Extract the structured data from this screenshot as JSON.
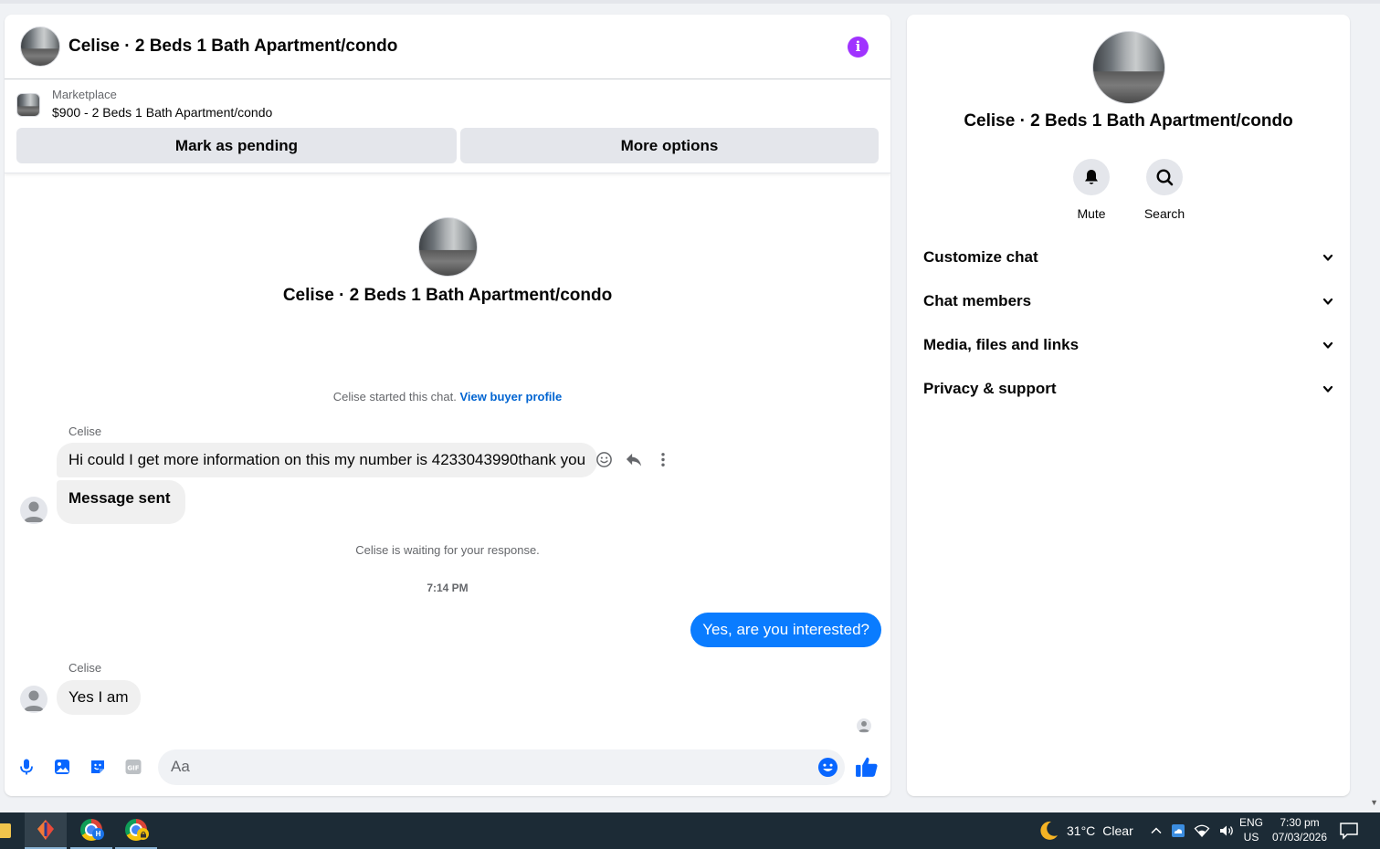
{
  "header": {
    "title": "Celise · 2 Beds 1 Bath Apartment/condo"
  },
  "listing": {
    "kicker": "Marketplace",
    "name": "$900 - 2 Beds 1 Bath Apartment/condo",
    "mark_pending_label": "Mark as pending",
    "more_options_label": "More options"
  },
  "conversation": {
    "intro_name": "Celise · 2 Beds 1 Bath Apartment/condo",
    "started_text": "Celise started this chat.",
    "view_profile_link": "View buyer profile",
    "messages": [
      {
        "sender": "Celise",
        "text": "Hi could I get more information on this my number is 4233043990thank you"
      },
      {
        "text": "Message sent"
      },
      {
        "sender": "Celise",
        "text": "Yes I am"
      }
    ],
    "waiting_text": "Celise is waiting for your response.",
    "timestamp": "7:14 PM",
    "outgoing": [
      {
        "text": "Yes, are you interested?"
      }
    ]
  },
  "composer": {
    "placeholder": "Aa"
  },
  "info_panel": {
    "name": "Celise · 2 Beds 1 Bath Apartment/condo",
    "actions": [
      {
        "label": "Mute",
        "icon": "bell-icon"
      },
      {
        "label": "Search",
        "icon": "search-icon"
      }
    ],
    "sections": [
      {
        "label": "Customize chat"
      },
      {
        "label": "Chat members"
      },
      {
        "label": "Media, files and links"
      },
      {
        "label": "Privacy & support"
      }
    ]
  },
  "taskbar": {
    "weather_temp": "31°C",
    "weather_cond": "Clear",
    "lang_top": "ENG",
    "lang_bottom": "US",
    "time": "7:30 pm",
    "date": "07/03/2026",
    "chrome_badge_1": "H"
  },
  "colors": {
    "accent_blue": "#0a7cff",
    "link_blue": "#0064d1",
    "info_purple": "#a033ff",
    "taskbar_bg": "#1c2b36"
  }
}
